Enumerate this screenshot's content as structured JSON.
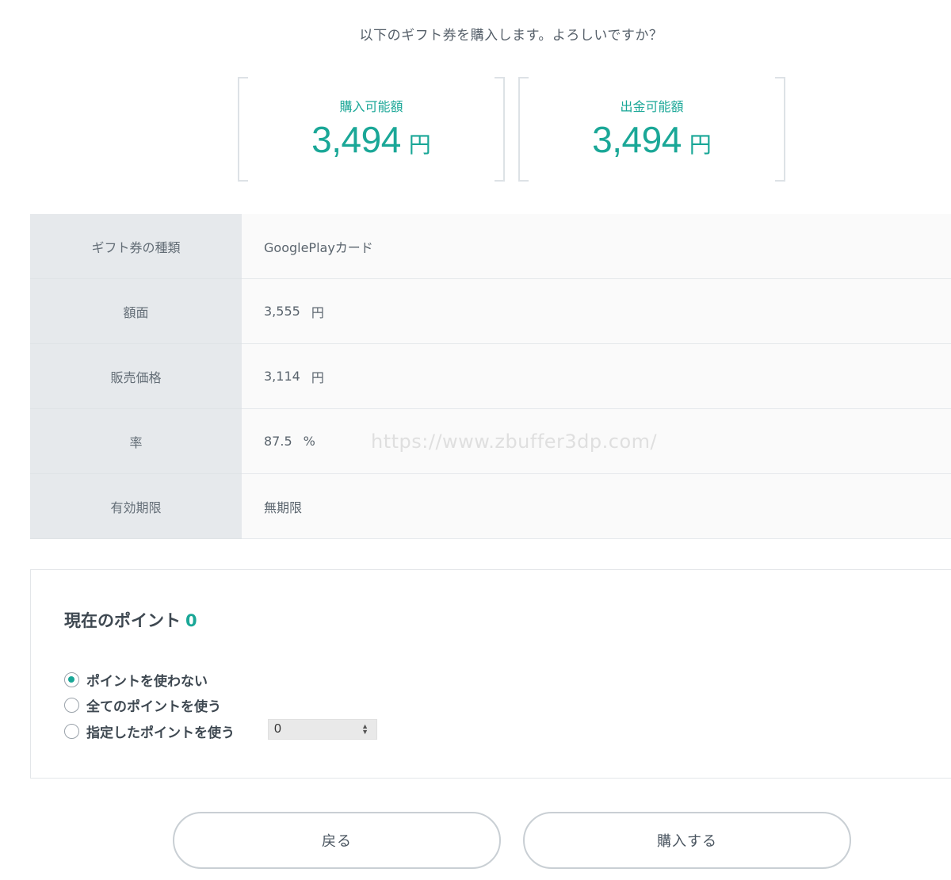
{
  "confirm_message": "以下のギフト券を購入します。よろしいですか？",
  "balances": [
    {
      "label": "購入可能額",
      "value": "3,494",
      "unit": "円"
    },
    {
      "label": "出金可能額",
      "value": "3,494",
      "unit": "円"
    }
  ],
  "details": [
    {
      "label": "ギフト券の種類",
      "value": "GooglePlayカード",
      "unit": ""
    },
    {
      "label": "額面",
      "value": "3,555",
      "unit": "円"
    },
    {
      "label": "販売価格",
      "value": "3,114",
      "unit": "円"
    },
    {
      "label": "率",
      "value": "87.5",
      "unit": "%"
    },
    {
      "label": "有効期限",
      "value": "無期限",
      "unit": ""
    }
  ],
  "watermark": "https://www.zbuffer3dp.com/",
  "points": {
    "title": "現在のポイント",
    "value": "0",
    "options": [
      {
        "label": "ポイントを使わない",
        "checked": true
      },
      {
        "label": "全てのポイントを使う",
        "checked": false
      },
      {
        "label": "指定したポイントを使う",
        "checked": false
      }
    ],
    "specified_value": "0"
  },
  "buttons": {
    "back": "戻る",
    "buy": "購入する"
  },
  "colors": {
    "accent": "#1aa797",
    "header_cell": "#e6e9ec",
    "value_cell": "#fafafa"
  }
}
